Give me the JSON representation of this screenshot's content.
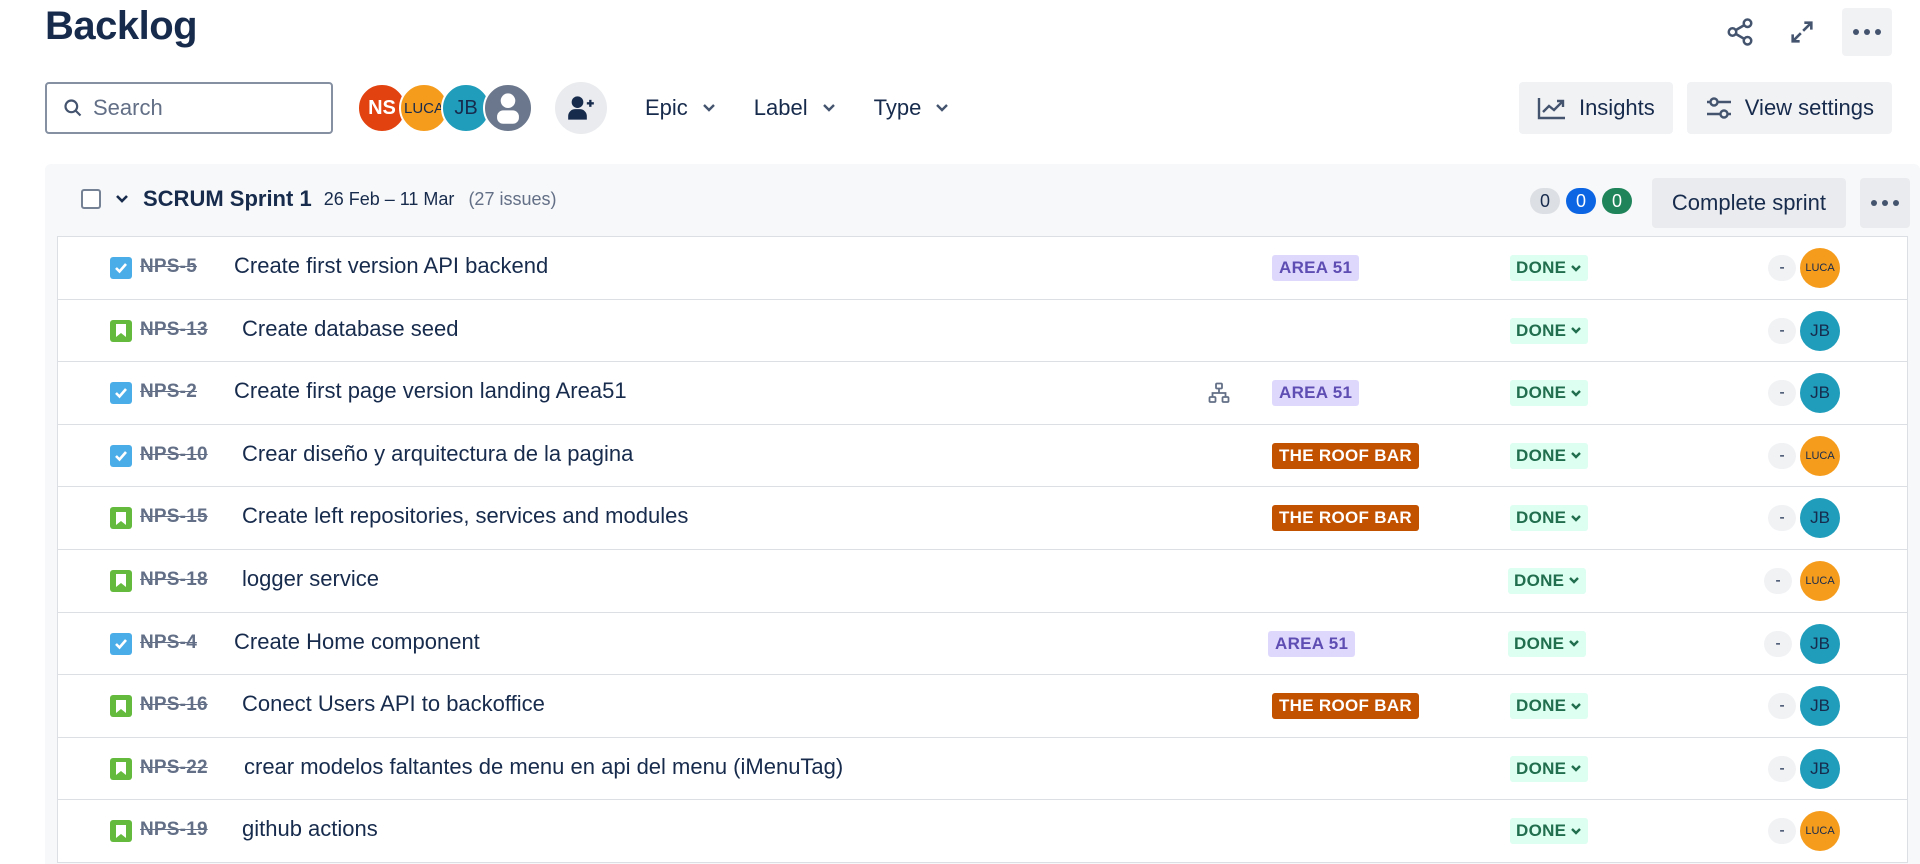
{
  "page": {
    "title": "Backlog"
  },
  "top_actions": {
    "share_icon": "share-icon",
    "expand_icon": "expand-icon",
    "more_icon": "more-icon"
  },
  "toolbar": {
    "search_placeholder": "Search",
    "avatars": [
      {
        "initials": "NS",
        "color": "#e2420f"
      },
      {
        "initials": "LUCA",
        "color": "#f69c1d"
      },
      {
        "initials": "JB",
        "color": "#1f9dbb"
      },
      {
        "initials": "",
        "color": "#6b778c"
      }
    ],
    "filters": [
      "Epic",
      "Label",
      "Type"
    ],
    "insights_label": "Insights",
    "view_settings_label": "View settings"
  },
  "sprint": {
    "name": "SCRUM Sprint 1",
    "dates": "26 Feb – 11 Mar",
    "issue_count": "(27 issues)",
    "counts": {
      "todo": "0",
      "in_progress": "0",
      "done": "0"
    },
    "complete_label": "Complete sprint"
  },
  "issues": [
    {
      "type": "task",
      "key": "NPS-5",
      "summary": "Create first version API backend",
      "epic": "AREA 51",
      "epic_color": "purple",
      "child": false,
      "status": "DONE",
      "estimate": "-",
      "assignee": "LUCA"
    },
    {
      "type": "story",
      "key": "NPS-13",
      "summary": "Create database seed",
      "epic": "",
      "epic_color": "",
      "child": false,
      "status": "DONE",
      "estimate": "-",
      "assignee": "JB"
    },
    {
      "type": "task",
      "key": "NPS-2",
      "summary": "Create first page version landing Area51",
      "epic": "AREA 51",
      "epic_color": "purple",
      "child": true,
      "status": "DONE",
      "estimate": "-",
      "assignee": "JB"
    },
    {
      "type": "task",
      "key": "NPS-10",
      "summary": "Crear diseño y arquitectura de la pagina",
      "epic": "THE ROOF BAR",
      "epic_color": "orange",
      "child": false,
      "status": "DONE",
      "estimate": "-",
      "assignee": "LUCA"
    },
    {
      "type": "story",
      "key": "NPS-15",
      "summary": "Create left repositories, services and modules",
      "epic": "THE ROOF BAR",
      "epic_color": "orange",
      "child": false,
      "status": "DONE",
      "estimate": "-",
      "assignee": "JB"
    },
    {
      "type": "story",
      "key": "NPS-18",
      "summary": "logger service",
      "epic": "",
      "epic_color": "",
      "child": false,
      "status": "DONE",
      "estimate": "-",
      "assignee": "LUCA"
    },
    {
      "type": "task",
      "key": "NPS-4",
      "summary": "Create Home component",
      "epic": "AREA 51",
      "epic_color": "purple",
      "child": false,
      "status": "DONE",
      "estimate": "-",
      "assignee": "JB"
    },
    {
      "type": "story",
      "key": "NPS-16",
      "summary": "Conect Users API to backoffice",
      "epic": "THE ROOF BAR",
      "epic_color": "orange",
      "child": false,
      "status": "DONE",
      "estimate": "-",
      "assignee": "JB"
    },
    {
      "type": "story",
      "key": "NPS-22",
      "summary": "crear modelos faltantes de menu en api del menu (iMenuTag)",
      "epic": "",
      "epic_color": "",
      "child": false,
      "status": "DONE",
      "estimate": "-",
      "assignee": "JB"
    },
    {
      "type": "story",
      "key": "NPS-19",
      "summary": "github actions",
      "epic": "",
      "epic_color": "",
      "child": false,
      "status": "DONE",
      "estimate": "-",
      "assignee": "LUCA"
    }
  ]
}
